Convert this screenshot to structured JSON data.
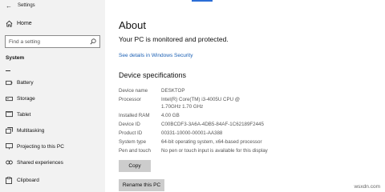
{
  "window": {
    "title": "Settings"
  },
  "sidebar": {
    "home_label": "Home",
    "search_placeholder": "Find a setting",
    "section_label": "System",
    "items": [
      {
        "label": "Battery"
      },
      {
        "label": "Storage"
      },
      {
        "label": "Tablet"
      },
      {
        "label": "Multitasking"
      },
      {
        "label": "Projecting to this PC"
      },
      {
        "label": "Shared experiences"
      },
      {
        "label": "Clipboard"
      }
    ]
  },
  "main": {
    "page_title": "About",
    "protection_text": "Your PC is monitored and protected.",
    "security_link": "See details in Windows Security",
    "specs_title": "Device specifications",
    "specs": [
      {
        "key": "Device name",
        "value": "DESKTOP"
      },
      {
        "key": "Processor",
        "value": "Intel(R) Core(TM) i3-4005U CPU @ 1.70GHz   1.70 GHz"
      },
      {
        "key": "Installed RAM",
        "value": "4.00 GB"
      },
      {
        "key": "Device ID",
        "value": "C00BCDF3-3A6A-4DB5-84AF-1C62189F2445"
      },
      {
        "key": "Product ID",
        "value": "00331-10000-00001-AA388"
      },
      {
        "key": "System type",
        "value": "64-bit operating system, x64-based processor"
      },
      {
        "key": "Pen and touch",
        "value": "No pen or touch input is available for this display"
      }
    ],
    "copy_button": "Copy",
    "rename_button": "Rename this PC"
  },
  "watermark": "wsxdn.com"
}
